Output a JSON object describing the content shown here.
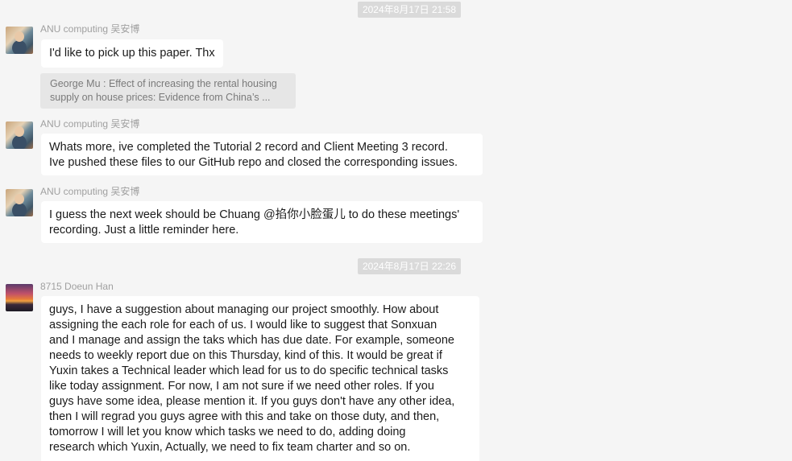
{
  "timestamps": [
    "2024年8月17日 21:58",
    "2024年8月17日 22:26"
  ],
  "messages": [
    {
      "sender": "ANU computing 吴安博",
      "lines": [
        "I'd like to pick up this paper. Thx"
      ],
      "quote": [
        "George Mu : Effect of increasing the rental housing",
        "supply on house prices: Evidence from China’s ..."
      ]
    },
    {
      "sender": "ANU computing 吴安博",
      "lines": [
        "Whats more, ive completed the Tutorial 2 record and Client Meeting 3 record.",
        "Ive pushed these files to our GitHub repo and closed the corresponding issues."
      ]
    },
    {
      "sender": "ANU computing 吴安博",
      "lines": [
        "I guess the next week should be Chuang @掐你小脸蛋儿  to do these meetings'",
        "recording. Just a little reminder here."
      ]
    },
    {
      "sender": "8715 Doeun Han",
      "lines": [
        "guys, I have a suggestion about managing our project smoothly. How about",
        "assigning the each role for each of us. I would like to suggest that Sonxuan",
        "and I manage and assign the taks which has due date. For example, someone",
        "needs to weekly report due on this Thursday, kind of this. It would be great if",
        "Yuxin takes a Technical leader which lead for us to do specific technical tasks",
        "like today assignment. For now, I am not sure if we need other roles. If you",
        "guys have some idea, please mention it. If you guys don't have any other idea,",
        "then I will regrad you guys agree with this and take on those duty, and then,",
        "tomorrow I will let you know which tasks we need to do, adding doing",
        "research which Yuxin, Actually, we need to fix team charter and so on."
      ]
    }
  ]
}
